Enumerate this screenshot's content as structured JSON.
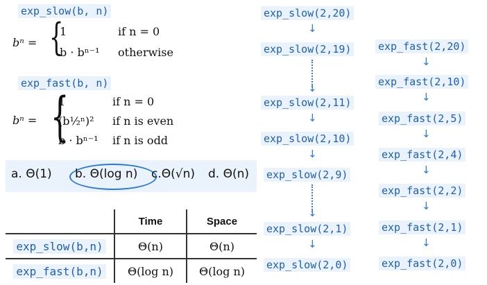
{
  "left": {
    "slow_title": "exp_slow(b, n)",
    "slow_lhs": "bⁿ =",
    "slow_cases": [
      {
        "expr": "1",
        "cond": "if n = 0"
      },
      {
        "expr": "b · bⁿ⁻¹",
        "cond": "otherwise"
      }
    ],
    "fast_title": "exp_fast(b, n)",
    "fast_lhs": "bⁿ =",
    "fast_cases": [
      {
        "expr": "1",
        "cond": "if n = 0"
      },
      {
        "expr": "(b½ⁿ)²",
        "cond": "if n is even"
      },
      {
        "expr": "b · bⁿ⁻¹",
        "cond": "if n is odd"
      }
    ]
  },
  "answers": {
    "a": "a. Θ(1)",
    "b": "b. Θ(log n)",
    "c": "c.Θ(√n)",
    "d": "d. Θ(n)"
  },
  "table": {
    "headers": [
      "",
      "Time",
      "Space"
    ],
    "rows": [
      {
        "name": "exp_slow(b,n)",
        "time": "Θ(n)",
        "space": "Θ(n)"
      },
      {
        "name": "exp_fast(b,n)",
        "time": "Θ(log n)",
        "space": "Θ(log n)"
      }
    ]
  },
  "slow_chain": [
    "exp_slow(2,20)",
    "exp_slow(2,19)",
    "exp_slow(2,11)",
    "exp_slow(2,10)",
    "exp_slow(2,9)",
    "exp_slow(2,1)",
    "exp_slow(2,0)"
  ],
  "fast_chain": [
    "exp_fast(2,20)",
    "exp_fast(2,10)",
    "exp_fast(2,5)",
    "exp_fast(2,4)",
    "exp_fast(2,2)",
    "exp_fast(2,1)",
    "exp_fast(2,0)"
  ],
  "icons": {
    "arrow": "down-arrow-icon",
    "ellipsis": "vertical-dots-icon"
  },
  "colors": {
    "code_text": "#1e5fb4",
    "code_bg": "#eaf2fb",
    "arrow": "#2a78d8"
  }
}
